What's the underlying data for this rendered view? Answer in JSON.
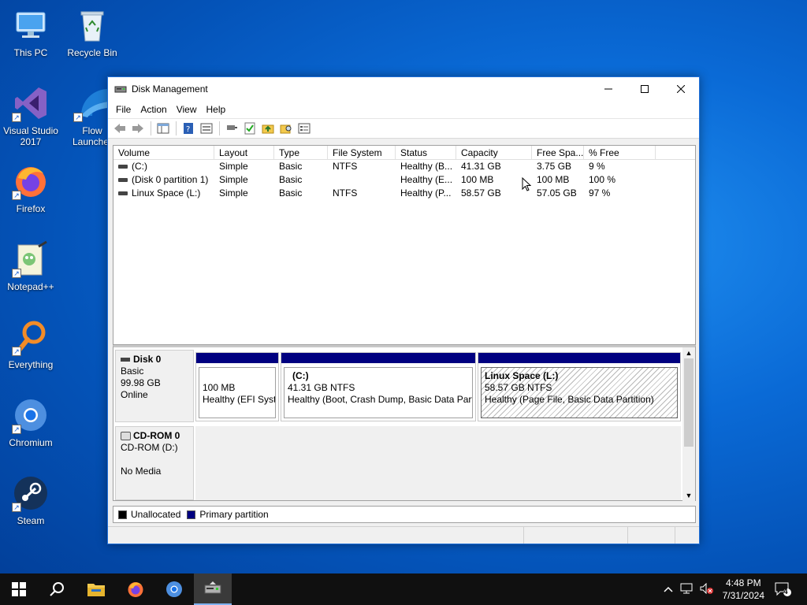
{
  "desktop": {
    "icons": [
      {
        "label": "This PC"
      },
      {
        "label": "Recycle Bin"
      },
      {
        "label": "Visual Studio 2017"
      },
      {
        "label": "Flow Launcher"
      },
      {
        "label": "Firefox"
      },
      {
        "label": "Notepad++"
      },
      {
        "label": "Everything"
      },
      {
        "label": "Chromium"
      },
      {
        "label": "Steam"
      }
    ]
  },
  "window": {
    "title": "Disk Management",
    "menu": [
      "File",
      "Action",
      "View",
      "Help"
    ]
  },
  "volume_list": {
    "columns": [
      "Volume",
      "Layout",
      "Type",
      "File System",
      "Status",
      "Capacity",
      "Free Spa...",
      "% Free"
    ],
    "rows": [
      [
        "(C:)",
        "Simple",
        "Basic",
        "NTFS",
        "Healthy (B...",
        "41.31 GB",
        "3.75 GB",
        "9 %"
      ],
      [
        "(Disk 0 partition 1)",
        "Simple",
        "Basic",
        "",
        "Healthy (E...",
        "100 MB",
        "100 MB",
        "100 %"
      ],
      [
        "Linux Space (L:)",
        "Simple",
        "Basic",
        "NTFS",
        "Healthy (P...",
        "58.57 GB",
        "57.05 GB",
        "97 %"
      ]
    ]
  },
  "disks": {
    "disk0": {
      "name": "Disk 0",
      "type": "Basic",
      "size": "99.98 GB",
      "status": "Online"
    },
    "cdrom0": {
      "name": "CD-ROM 0",
      "drive": "CD-ROM (D:)",
      "status": "No Media"
    }
  },
  "partitions": {
    "efi": {
      "title": "",
      "size": "100 MB",
      "status": "Healthy (EFI Syste"
    },
    "c": {
      "title": "(C:)",
      "size": "41.31 GB NTFS",
      "status": "Healthy (Boot, Crash Dump, Basic Data Partit"
    },
    "linux": {
      "title": "Linux Space  (L:)",
      "size": "58.57 GB NTFS",
      "status": "Healthy (Page File, Basic Data Partition)"
    }
  },
  "legend": {
    "unallocated": "Unallocated",
    "primary": "Primary partition"
  },
  "taskbar": {
    "time": "4:48 PM",
    "date": "7/31/2024",
    "notifications": "4"
  },
  "colors": {
    "primary_partition": "#000080",
    "unallocated": "#000000",
    "taskbar": "#101010"
  }
}
